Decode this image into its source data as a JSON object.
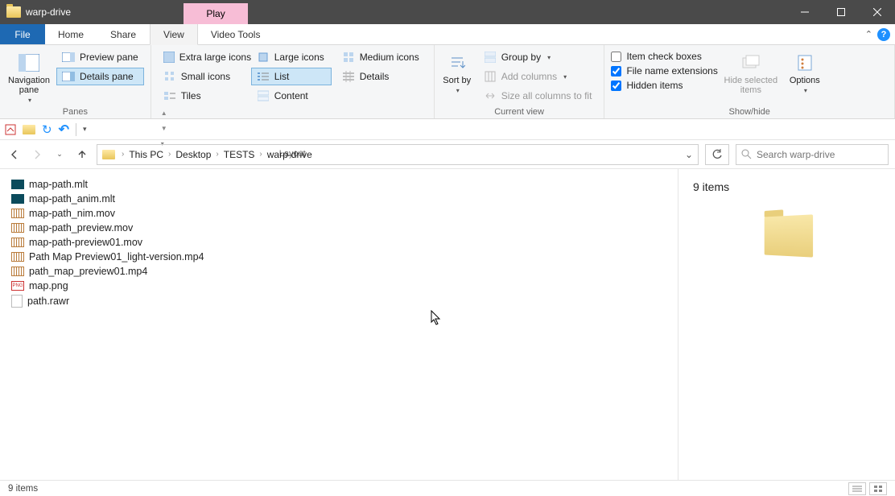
{
  "window": {
    "title": "warp-drive",
    "context_tab": "Play"
  },
  "tabs": {
    "file": "File",
    "home": "Home",
    "share": "Share",
    "view": "View",
    "video": "Video Tools"
  },
  "ribbon": {
    "panes": {
      "nav": "Navigation pane",
      "preview": "Preview pane",
      "details": "Details pane",
      "label": "Panes"
    },
    "layout": {
      "xl": "Extra large icons",
      "lg": "Large icons",
      "md": "Medium icons",
      "sm": "Small icons",
      "list": "List",
      "details": "Details",
      "tiles": "Tiles",
      "content": "Content",
      "label": "Layout"
    },
    "currentview": {
      "sort": "Sort by",
      "group": "Group by",
      "addcols": "Add columns",
      "sizecols": "Size all columns to fit",
      "label": "Current view"
    },
    "showhide": {
      "itemcheck": "Item check boxes",
      "ext": "File name extensions",
      "hidden": "Hidden items",
      "hidesel": "Hide selected items",
      "options": "Options",
      "label": "Show/hide"
    }
  },
  "breadcrumbs": [
    "This PC",
    "Desktop",
    "TESTS",
    "warp-drive"
  ],
  "search_placeholder": "Search warp-drive",
  "files": [
    {
      "name": "map-path.mlt",
      "icon": "mlt"
    },
    {
      "name": "map-path_anim.mlt",
      "icon": "mlt"
    },
    {
      "name": "map-path_nim.mov",
      "icon": "mov"
    },
    {
      "name": "map-path_preview.mov",
      "icon": "mov"
    },
    {
      "name": "map-path-preview01.mov",
      "icon": "mov"
    },
    {
      "name": "Path Map Preview01_light-version.mp4",
      "icon": "mov"
    },
    {
      "name": "path_map_preview01.mp4",
      "icon": "mov"
    },
    {
      "name": "map.png",
      "icon": "png"
    },
    {
      "name": "path.rawr",
      "icon": "blank"
    }
  ],
  "preview_summary": "9 items",
  "statusbar": "9 items"
}
